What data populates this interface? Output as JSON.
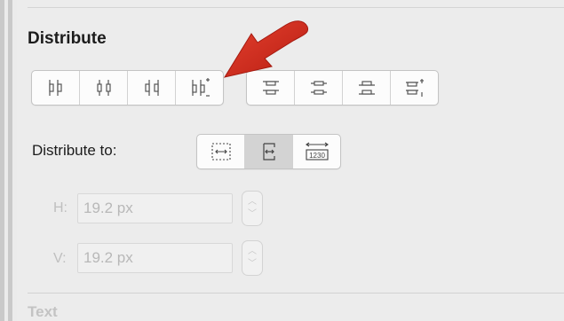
{
  "distribute": {
    "title": "Distribute",
    "horizontal_buttons": [
      {
        "icon": "distribute-left-edges-icon"
      },
      {
        "icon": "distribute-centers-horizontally-icon"
      },
      {
        "icon": "distribute-right-edges-icon"
      },
      {
        "icon": "distribute-horizontal-spacing-icon"
      }
    ],
    "vertical_buttons": [
      {
        "icon": "distribute-top-edges-icon"
      },
      {
        "icon": "distribute-centers-vertically-icon"
      },
      {
        "icon": "distribute-bottom-edges-icon"
      },
      {
        "icon": "distribute-vertical-spacing-icon"
      }
    ],
    "distribute_to": {
      "label": "Distribute to:",
      "options": [
        {
          "icon": "distribute-to-selection-icon"
        },
        {
          "icon": "distribute-to-spacing-icon",
          "selected": true
        },
        {
          "icon": "distribute-to-fixed-value-icon"
        }
      ]
    },
    "h": {
      "label": "H:",
      "value": "19.2 px"
    },
    "v": {
      "label": "V:",
      "value": "19.2 px"
    }
  },
  "text_section": {
    "title": "Text"
  },
  "annotation": {
    "arrow_color": "#d8261a"
  }
}
